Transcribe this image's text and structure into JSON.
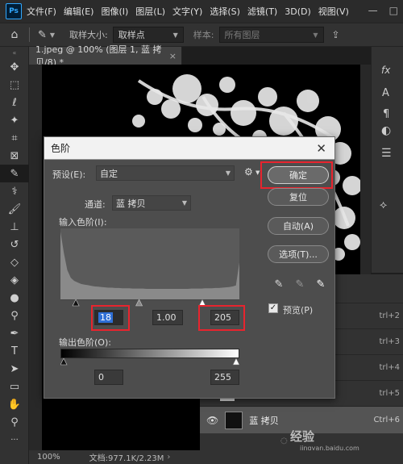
{
  "app": {
    "logo": "Ps"
  },
  "menu": [
    "文件(F)",
    "编辑(E)",
    "图像(I)",
    "图层(L)",
    "文字(Y)",
    "选择(S)",
    "滤镜(T)",
    "3D(D)",
    "视图(V)"
  ],
  "window_controls": [
    "—",
    "□",
    "✕"
  ],
  "options_bar": {
    "sample_size_label": "取样大小:",
    "sample_size_value": "取样点",
    "sample_label": "样本:",
    "sample_value": "所有图层"
  },
  "document_tab": {
    "title": "1.jpeg @ 100% (图层 1, 蓝 拷贝/8) *",
    "close": "×"
  },
  "status_bar": {
    "zoom": "100%",
    "doc_info": "文档:977.1K/2.23M"
  },
  "layers": {
    "shortcuts": [
      "trl+2",
      "trl+3",
      "trl+4",
      "trl+5"
    ],
    "active_layer": {
      "name": "蓝 拷贝",
      "shortcut": "Ctrl+6"
    },
    "partial_layer_label": "蓝"
  },
  "watermark": {
    "site": "jingyan.baidu.com",
    "brand": "经验"
  },
  "levels_dialog": {
    "title": "色阶",
    "preset_label": "预设(E):",
    "preset_value": "自定",
    "channel_label": "通道:",
    "channel_value": "蓝 拷贝",
    "input_levels_label": "输入色阶(I):",
    "input_black": "18",
    "input_gamma": "1.00",
    "input_white": "205",
    "output_levels_label": "输出色阶(O):",
    "output_black": "0",
    "output_white": "255",
    "buttons": {
      "ok": "确定",
      "reset": "复位",
      "auto": "自动(A)",
      "options": "选项(T)..."
    },
    "preview_label": "预览(P)",
    "preview_checked": true,
    "input_slider_levels": {
      "black": 18,
      "gamma": 1.0,
      "white": 205
    },
    "histogram": [
      220,
      150,
      95,
      70,
      60,
      55,
      50,
      48,
      46,
      44,
      42,
      41,
      40,
      39,
      38,
      38,
      37,
      37,
      36,
      36,
      36,
      35,
      35,
      35,
      35,
      34,
      34,
      34,
      34,
      34,
      34,
      34,
      34,
      34,
      34,
      34,
      34,
      34,
      35,
      35,
      35,
      35,
      36,
      36,
      36,
      37,
      37,
      38,
      39,
      40,
      42,
      45,
      120
    ],
    "histogram_max": 220
  },
  "colors": {
    "accent_red": "#e8242e",
    "dialog_bg": "#4d4d4d",
    "ps_blue": "#31a8ff"
  }
}
